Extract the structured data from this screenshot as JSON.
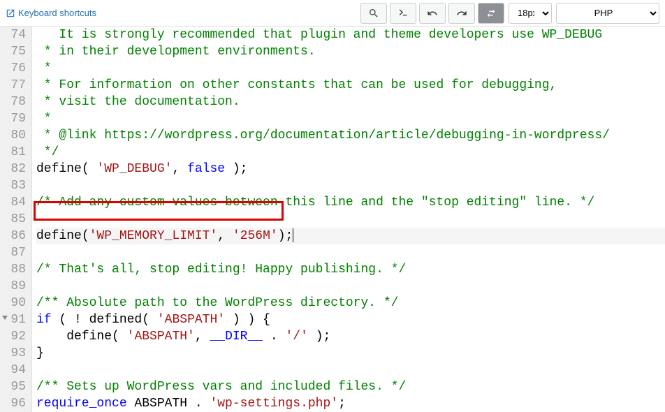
{
  "toolbar": {
    "kb_link": "Keyboard shortcuts",
    "font_size": "18px",
    "language": "PHP"
  },
  "icons": {
    "external": "external-link-icon",
    "search": "search-icon",
    "console": "console-icon",
    "undo": "undo-icon",
    "redo": "redo-icon",
    "wrap": "wrap-icon"
  },
  "gutter": {
    "start": 74,
    "end": 96,
    "fold_at": 91
  },
  "lines": [
    {
      "n": 74,
      "t": "comment",
      "text": "   It is strongly recommended that plugin and theme developers use WP_DEBUG",
      "cut": true
    },
    {
      "n": 75,
      "t": "comment",
      "text": " * in their development environments."
    },
    {
      "n": 76,
      "t": "comment",
      "text": " *"
    },
    {
      "n": 77,
      "t": "comment",
      "text": " * For information on other constants that can be used for debugging,"
    },
    {
      "n": 78,
      "t": "comment",
      "text": " * visit the documentation."
    },
    {
      "n": 79,
      "t": "comment",
      "text": " *"
    },
    {
      "n": 80,
      "t": "comment",
      "text": " * @link https://wordpress.org/documentation/article/debugging-in-wordpress/"
    },
    {
      "n": 81,
      "t": "comment",
      "text": " */"
    },
    {
      "n": 82,
      "t": "define1",
      "fn": "define",
      "s1": "'WP_DEBUG'",
      "kw": "false"
    },
    {
      "n": 83,
      "t": "blank"
    },
    {
      "n": 84,
      "t": "comment",
      "text": "/* Add any custom values between this line and the \"stop editing\" line. */"
    },
    {
      "n": 85,
      "t": "blank"
    },
    {
      "n": 86,
      "t": "define2",
      "fn": "define",
      "s1": "'WP_MEMORY_LIMIT'",
      "s2": "'256M'",
      "hl": true,
      "cursor": true
    },
    {
      "n": 87,
      "t": "blank"
    },
    {
      "n": 88,
      "t": "comment",
      "text": "/* That's all, stop editing! Happy publishing. */"
    },
    {
      "n": 89,
      "t": "blank"
    },
    {
      "n": 90,
      "t": "comment",
      "text": "/** Absolute path to the WordPress directory. */"
    },
    {
      "n": 91,
      "t": "if",
      "kw1": "if",
      "fn": "defined",
      "s1": "'ABSPATH'"
    },
    {
      "n": 92,
      "t": "define3",
      "fn": "define",
      "s1": "'ABSPATH'",
      "kw": "__DIR__",
      "s2": "'/'"
    },
    {
      "n": 93,
      "t": "brace",
      "text": "}"
    },
    {
      "n": 94,
      "t": "blank"
    },
    {
      "n": 95,
      "t": "comment",
      "text": "/** Sets up WordPress vars and included files. */"
    },
    {
      "n": 96,
      "t": "req",
      "kw": "require_once",
      "id": "ABSPATH",
      "s1": "'wp-settings.php'"
    }
  ]
}
